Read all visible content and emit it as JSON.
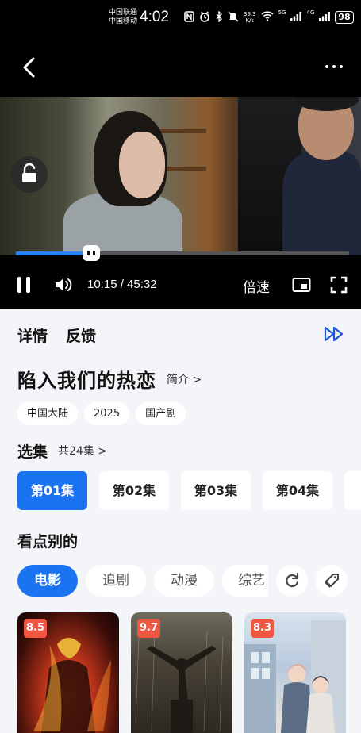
{
  "status_bar": {
    "carrier_1": "中国联通",
    "carrier_2": "中国移动",
    "time": "4:02",
    "net_speed_value": "39.3",
    "net_speed_unit": "K/s",
    "signal_5g": "5G",
    "signal_4g": "4G",
    "battery": "98"
  },
  "player": {
    "current_time": "10:15",
    "total_time": "45:32",
    "time_display": "10:15 / 45:32",
    "progress": 0.225,
    "speed_label": "倍速"
  },
  "tabs": [
    "详情",
    "反馈"
  ],
  "show": {
    "title": "陷入我们的热恋",
    "intro_label": "简介 >",
    "tags": [
      "中国大陆",
      "2025",
      "国产剧"
    ]
  },
  "episodes": {
    "section_title": "选集",
    "count_label": "共24集 >",
    "items": [
      "第01集",
      "第02集",
      "第03集",
      "第04集"
    ],
    "selected_index": 0
  },
  "recommend": {
    "section_title": "看点别的",
    "categories": [
      "电影",
      "追剧",
      "动漫",
      "综艺"
    ],
    "selected_index": 0,
    "posters": [
      {
        "rating": "8.5"
      },
      {
        "rating": "9.7"
      },
      {
        "rating": "8.3"
      }
    ]
  },
  "colors": {
    "accent": "#1a73f0",
    "rating_badge": "#f05642",
    "progress_fill": "#2a83f5"
  },
  "icons": [
    "back-icon",
    "more-icon",
    "unlock-icon",
    "pause-icon",
    "volume-icon",
    "pip-icon",
    "fullscreen-icon",
    "fast-forward-icon",
    "refresh-icon",
    "tag-icon"
  ]
}
